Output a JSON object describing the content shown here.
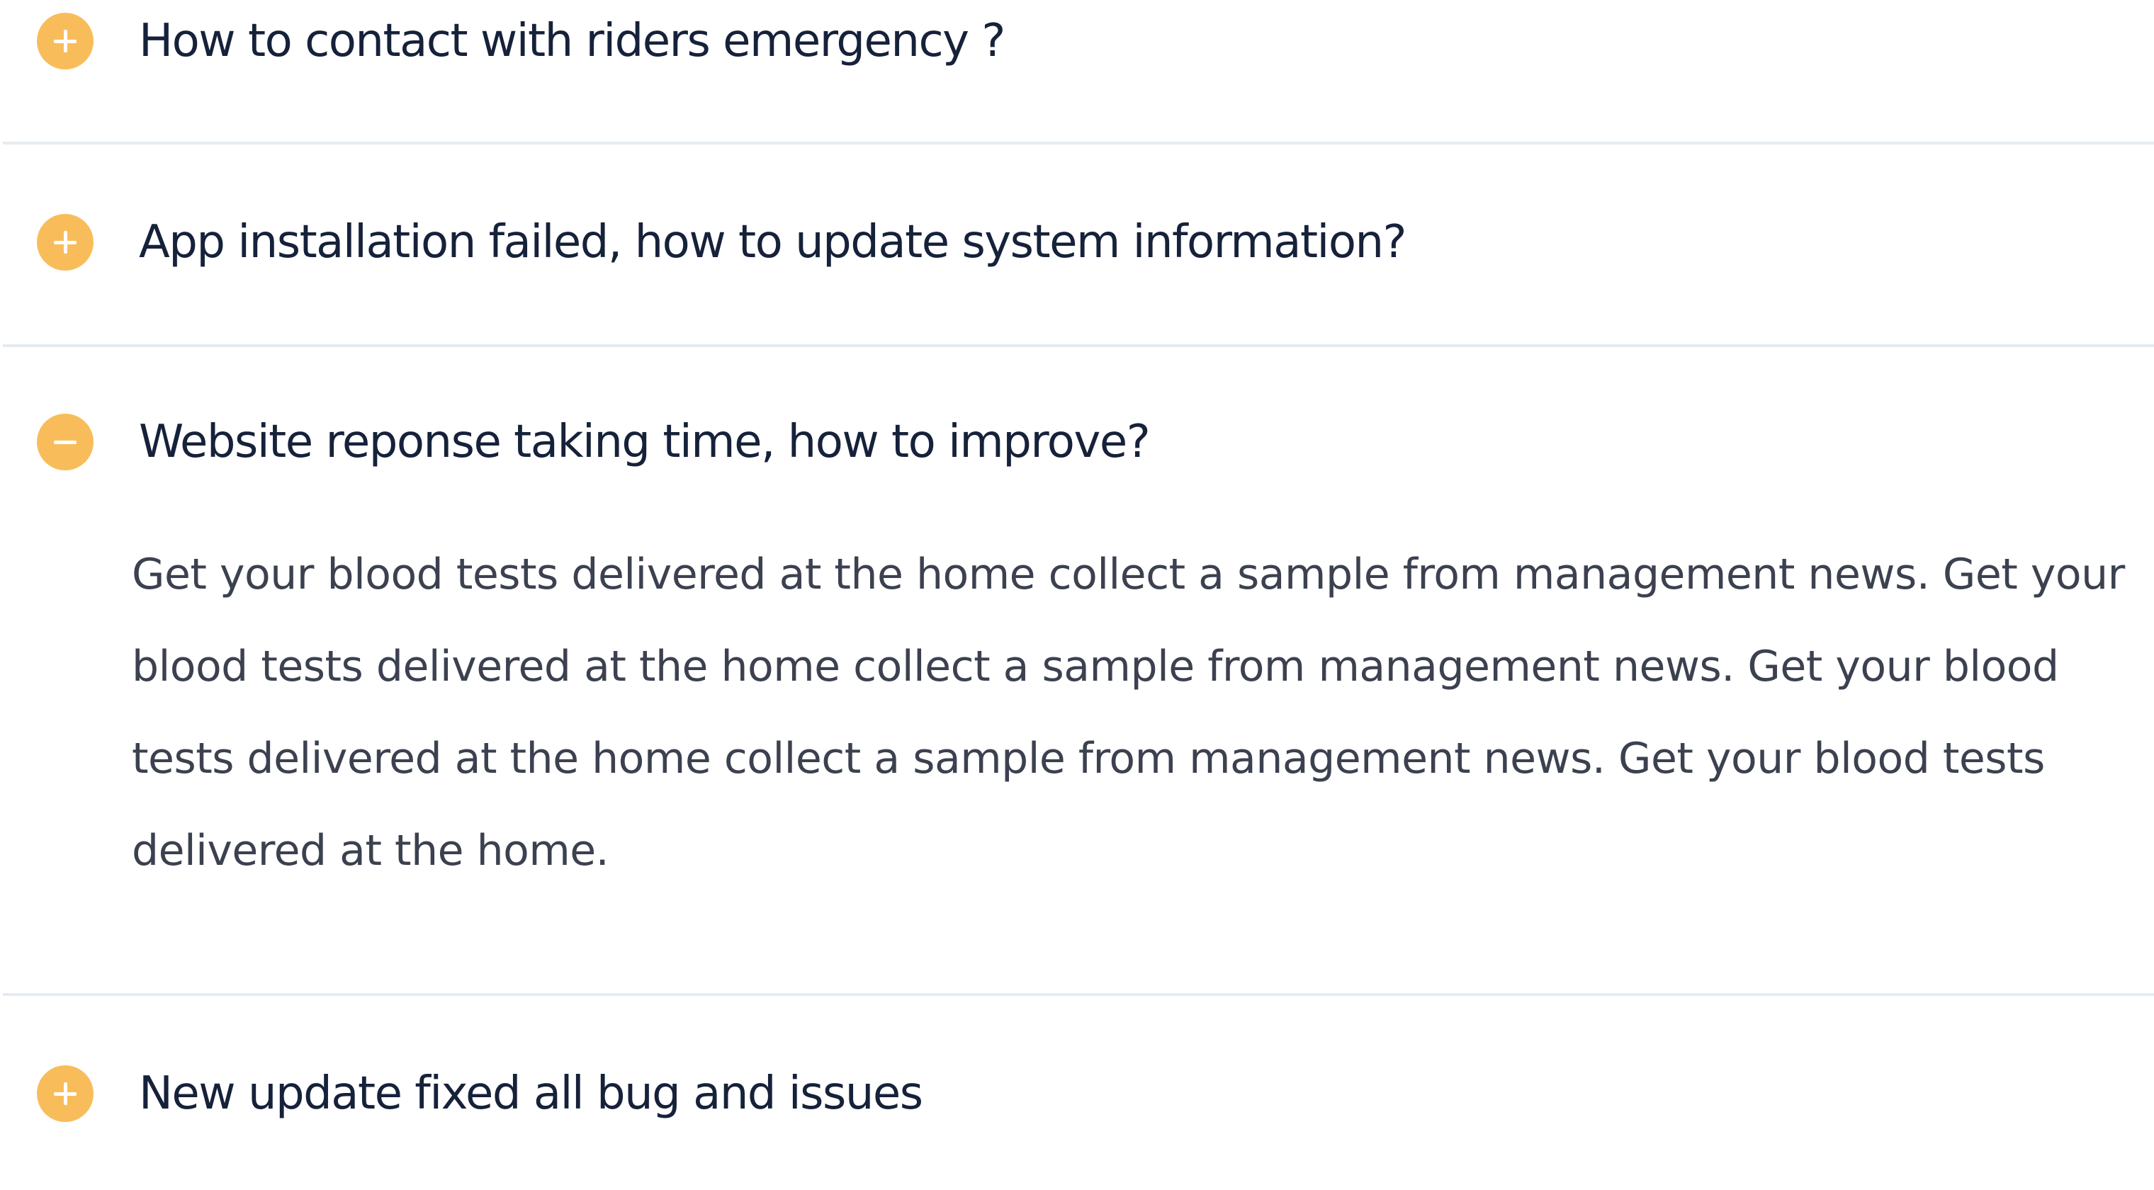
{
  "faq": {
    "items": [
      {
        "question": "How to contact with riders emergency ?",
        "state": "collapsed",
        "toggle_icon": "plus-icon"
      },
      {
        "question": "App installation failed, how to update system information?",
        "state": "collapsed",
        "toggle_icon": "plus-icon"
      },
      {
        "question": "Website reponse taking time, how to improve?",
        "state": "expanded",
        "toggle_icon": "minus-icon",
        "answer": "Get your blood tests delivered at the home collect a sample from management news. Get your blood tests delivered at the home collect a sample from management news. Get your blood tests delivered at the home collect a sample from management news. Get your blood tests delivered at the home."
      },
      {
        "question": "New update fixed all bug and issues",
        "state": "collapsed",
        "toggle_icon": "plus-icon"
      }
    ],
    "colors": {
      "accent": "#f8bd5a",
      "question_text": "#16213a",
      "answer_text": "#3c4150",
      "divider": "#e4ebf1"
    }
  }
}
